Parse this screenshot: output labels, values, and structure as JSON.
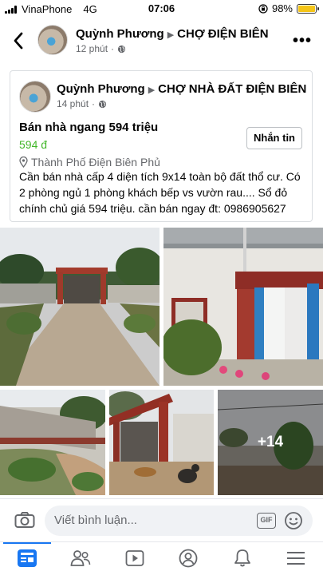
{
  "status_bar": {
    "carrier": "VinaPhone",
    "network": "4G",
    "time": "07:06",
    "battery": "98%",
    "battery_level": 0.98
  },
  "header": {
    "author": "Quỳnh Phương",
    "group": "CHỢ ĐIỆN BIÊN",
    "time": "12 phút"
  },
  "shared": {
    "author": "Quỳnh Phương",
    "group": "CHỢ NHÀ ĐẤT ĐIỆN BIÊN",
    "time": "14 phút",
    "item_title": "Bán nhà ngang 594 triệu",
    "price": "594 đ",
    "location": "Thành Phố Điện Biên Phủ",
    "message_button": "Nhắn tin",
    "description": "Cần bán nhà cấp 4 diện tích 9x14 toàn bộ đất thổ cư. Có 2 phòng ngủ 1 phòng khách bếp vs vườn rau.... Sổ đỏ chính chủ giá 594 triệu. cần bán ngay đt: 0986905627"
  },
  "photos": {
    "more_count": "+14"
  },
  "comment": {
    "placeholder": "Viết bình luận...",
    "gif_label": "GIF"
  },
  "colors": {
    "accent": "#1877f2",
    "price": "#42b72a",
    "muted": "#65676b"
  }
}
